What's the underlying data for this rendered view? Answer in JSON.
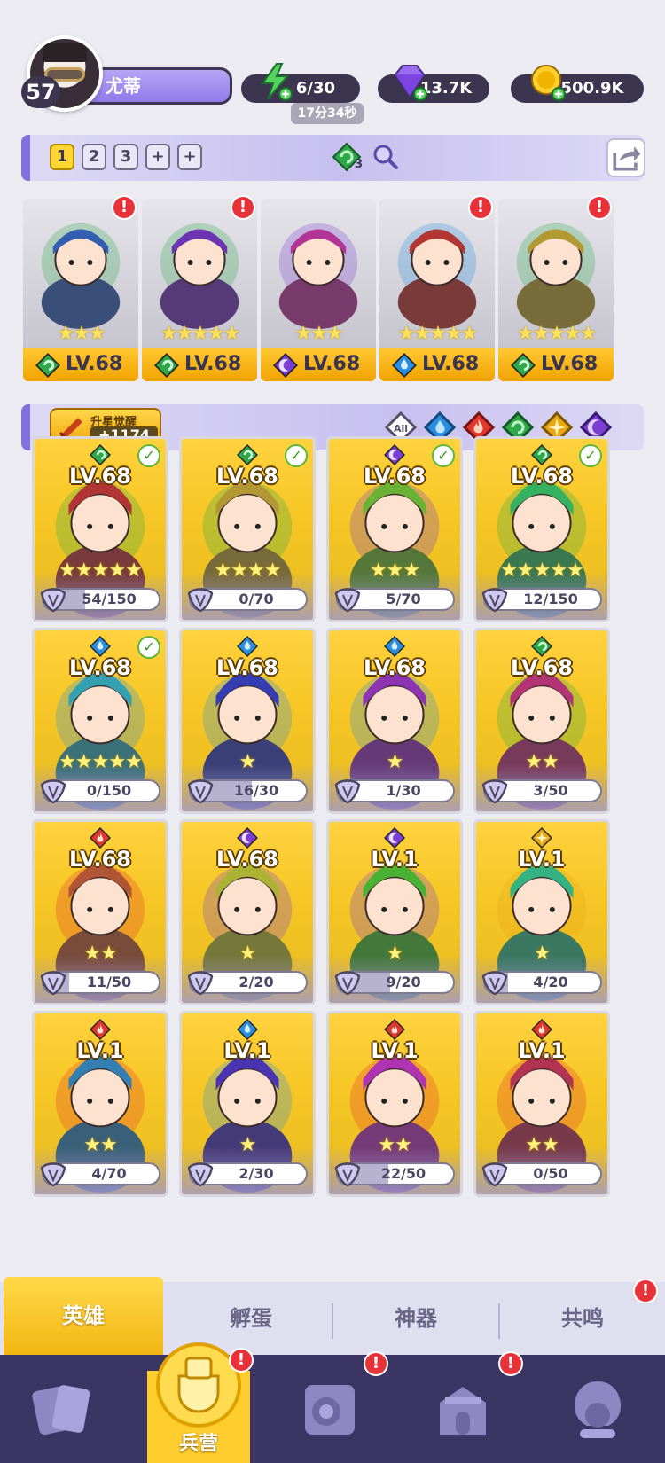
{
  "player": {
    "level": "57",
    "name": "尤蒂"
  },
  "resources": {
    "energy": "6/30",
    "energy_timer": "17分34秒",
    "gems": "13.7K",
    "coins": "500.9K"
  },
  "team": {
    "tabs": [
      "1",
      "2",
      "3",
      "+",
      "+"
    ],
    "active_tab": "1",
    "filter_badge": "3",
    "cards": [
      {
        "level": "LV.68",
        "element": "nature",
        "stars": 3,
        "alert": true
      },
      {
        "level": "LV.68",
        "element": "nature",
        "stars": 5,
        "alert": true
      },
      {
        "level": "LV.68",
        "element": "shadow",
        "stars": 3,
        "alert": false
      },
      {
        "level": "LV.68",
        "element": "water",
        "stars": 5,
        "alert": true
      },
      {
        "level": "LV.68",
        "element": "nature",
        "stars": 5,
        "alert": true
      }
    ]
  },
  "awaken": {
    "label": "升星觉醒",
    "value": "+1174"
  },
  "element_filters": [
    "All",
    "water",
    "fire",
    "nature",
    "light",
    "shadow"
  ],
  "element_all_label": "All",
  "heroes": [
    {
      "level": "LV.68",
      "element": "nature",
      "stars": 5,
      "shards": "54/150",
      "fill": 0.36,
      "check": true
    },
    {
      "level": "LV.68",
      "element": "nature",
      "stars": 4,
      "shards": "0/70",
      "fill": 0.0,
      "check": true
    },
    {
      "level": "LV.68",
      "element": "shadow",
      "stars": 3,
      "shards": "5/70",
      "fill": 0.07,
      "check": true
    },
    {
      "level": "LV.68",
      "element": "nature",
      "stars": 5,
      "shards": "12/150",
      "fill": 0.08,
      "check": true
    },
    {
      "level": "LV.68",
      "element": "water",
      "stars": 5,
      "shards": "0/150",
      "fill": 0.0,
      "check": true
    },
    {
      "level": "LV.68",
      "element": "water",
      "stars": 1,
      "shards": "16/30",
      "fill": 0.53,
      "check": false
    },
    {
      "level": "LV.68",
      "element": "water",
      "stars": 1,
      "shards": "1/30",
      "fill": 0.03,
      "check": false
    },
    {
      "level": "LV.68",
      "element": "nature",
      "stars": 2,
      "shards": "3/50",
      "fill": 0.06,
      "check": false
    },
    {
      "level": "LV.68",
      "element": "fire",
      "stars": 2,
      "shards": "11/50",
      "fill": 0.22,
      "check": false
    },
    {
      "level": "LV.68",
      "element": "shadow",
      "stars": 1,
      "shards": "2/20",
      "fill": 0.1,
      "check": false
    },
    {
      "level": "LV.1",
      "element": "shadow",
      "stars": 1,
      "shards": "9/20",
      "fill": 0.45,
      "check": false
    },
    {
      "level": "LV.1",
      "element": "light",
      "stars": 1,
      "shards": "4/20",
      "fill": 0.2,
      "check": false
    },
    {
      "level": "LV.1",
      "element": "fire",
      "stars": 2,
      "shards": "4/70",
      "fill": 0.06,
      "check": false
    },
    {
      "level": "LV.1",
      "element": "water",
      "stars": 1,
      "shards": "2/30",
      "fill": 0.07,
      "check": false
    },
    {
      "level": "LV.1",
      "element": "fire",
      "stars": 2,
      "shards": "22/50",
      "fill": 0.44,
      "check": false
    },
    {
      "level": "LV.1",
      "element": "fire",
      "stars": 2,
      "shards": "0/50",
      "fill": 0.0,
      "check": false
    }
  ],
  "subtabs": {
    "heroes": "英雄",
    "hatch": "孵蛋",
    "artifacts": "神器",
    "resonance": "共鸣"
  },
  "nav": {
    "barracks": "兵营"
  },
  "colors": {
    "nature": "#2fa84a",
    "water": "#2a8ee0",
    "fire": "#e2372b",
    "light": "#e8a712",
    "shadow": "#7a3fd1",
    "accent": "#8370e0",
    "gold": "#ffcc33",
    "dark": "#3b3550"
  }
}
